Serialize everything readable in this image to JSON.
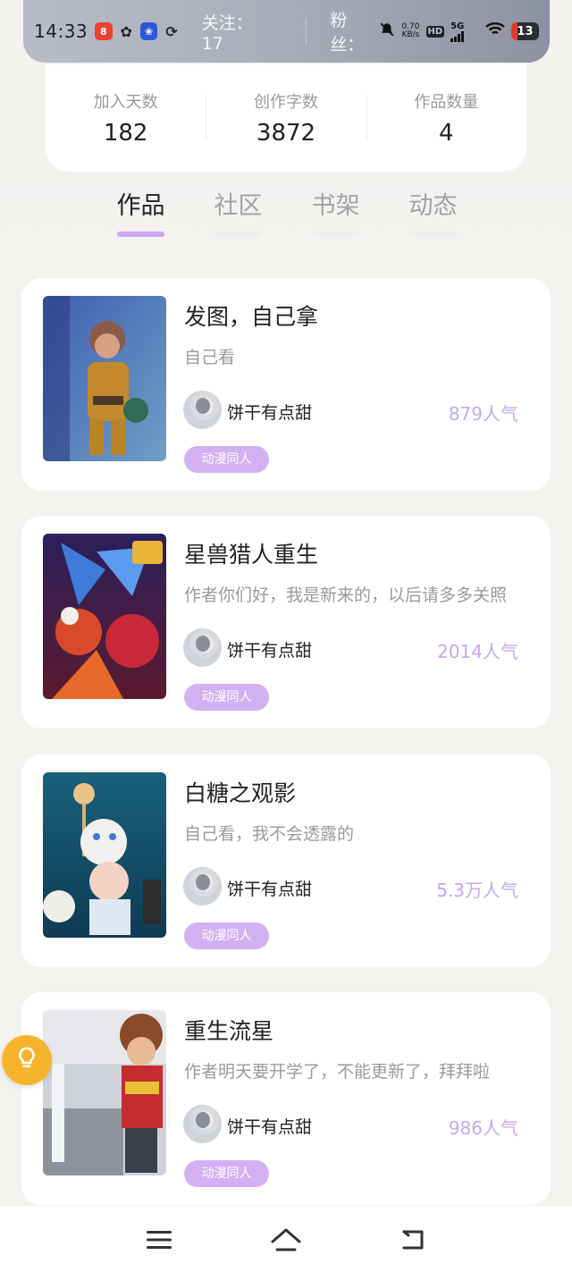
{
  "status_bar": {
    "time": "14:33",
    "app_icons": [
      "app-red-icon",
      "wechat-icon",
      "baidu-icon",
      "leaf-icon"
    ],
    "follow_label": "关注：17",
    "fans_label": "粉丝：",
    "speed_top": "0.70",
    "speed_bottom": "KB/s",
    "hd_label": "HD",
    "signal_label": "5G",
    "battery": "13"
  },
  "stats": [
    {
      "label": "加入天数",
      "value": "182"
    },
    {
      "label": "创作字数",
      "value": "3872"
    },
    {
      "label": "作品数量",
      "value": "4"
    }
  ],
  "tabs": [
    {
      "label": "作品",
      "active": true
    },
    {
      "label": "社区",
      "active": false
    },
    {
      "label": "书架",
      "active": false
    },
    {
      "label": "动态",
      "active": false
    }
  ],
  "works": [
    {
      "title": "发图，自己拿",
      "desc": "自己看",
      "author": "饼干有点甜",
      "popularity": "879人气",
      "tag": "动漫同人"
    },
    {
      "title": "星兽猎人重生",
      "desc": "作者你们好，我是新来的，以后请多多关照",
      "author": "饼干有点甜",
      "popularity": "2014人气",
      "tag": "动漫同人"
    },
    {
      "title": "白糖之观影",
      "desc": "自己看，我不会透露的",
      "author": "饼干有点甜",
      "popularity": "5.3万人气",
      "tag": "动漫同人"
    },
    {
      "title": "重生流星",
      "desc": "作者明天要开学了，不能更新了，拜拜啦",
      "author": "饼干有点甜",
      "popularity": "986人气",
      "tag": "动漫同人"
    }
  ],
  "colors": {
    "accent": "#c9a8ee",
    "tag_bg": "#d2b1f3",
    "popularity": "#c9a6ee",
    "bulb": "#f6b42c"
  },
  "nav": {
    "icons": [
      "menu-icon",
      "home-icon",
      "back-icon"
    ]
  }
}
